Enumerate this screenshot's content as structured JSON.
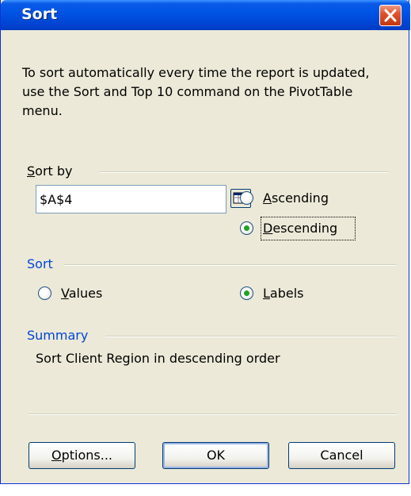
{
  "dialog": {
    "title": "Sort",
    "description": "To sort automatically every time the report is updated, use the Sort and Top 10 command on the PivotTable menu.",
    "sort_by": {
      "label_ul": "S",
      "label_rest": "ort by",
      "field_value": "$A$4",
      "ascending_ul": "A",
      "ascending_rest": "scending",
      "descending_ul": "D",
      "descending_rest": "escending",
      "selected": "Descending"
    },
    "sort": {
      "label": "Sort",
      "values_ul": "V",
      "values_rest": "alues",
      "labels_ul": "L",
      "labels_rest": "abels",
      "selected": "Labels"
    },
    "summary": {
      "label": "Summary",
      "text": "Sort Client Region in descending order"
    },
    "buttons": {
      "options_ul": "O",
      "options_rest": "ptions...",
      "ok": "OK",
      "cancel": "Cancel"
    }
  },
  "colors": {
    "title_bar": "#0055e5",
    "group_label_blue": "#0046d5",
    "dialog_bg": "#ece9d8",
    "radio_selected": "#21a121",
    "close_button": "#e0532b"
  }
}
